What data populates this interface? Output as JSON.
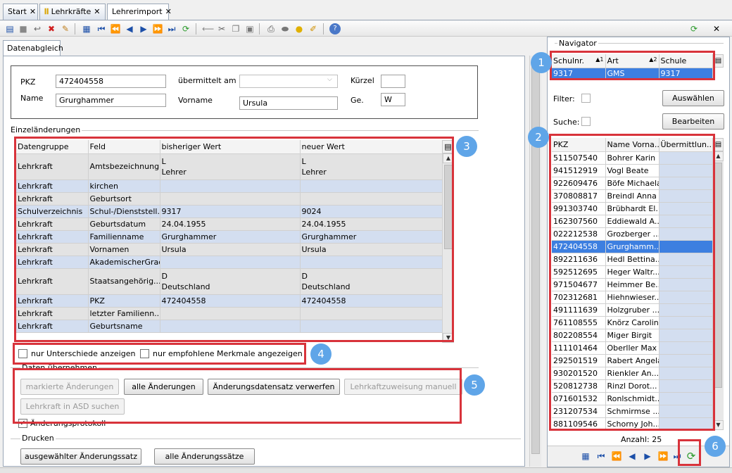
{
  "tabs": [
    {
      "label": "Start"
    },
    {
      "label": "Lehrkräfte"
    },
    {
      "label": "Lehrerimport"
    }
  ],
  "subtab": "Datenabgleich",
  "form": {
    "pkz_label": "PKZ",
    "pkz_value": "472404558",
    "uebermittelt_label": "übermittelt am",
    "uebermittelt_value": "",
    "kuerzel_label": "Kürzel",
    "kuerzel_value": "",
    "name_label": "Name",
    "name_value": "Grurghammer",
    "vorname_label": "Vorname",
    "vorname_value": "Ursula",
    "ge_label": "Ge.",
    "ge_value": "W"
  },
  "einzel": {
    "title": "Einzeländerungen",
    "headers": [
      "Datengruppe",
      "Feld",
      "bisheriger Wert",
      "neuer Wert"
    ],
    "rows": [
      {
        "c": [
          "Lehrkraft",
          "Amtsbezeichnung",
          "L\nLehrer",
          "L\nLehrer"
        ],
        "tall": true,
        "s": "r1"
      },
      {
        "c": [
          "Lehrkraft",
          "kirchen",
          "",
          ""
        ],
        "s": "r2"
      },
      {
        "c": [
          "Lehrkraft",
          "Geburtsort",
          "",
          ""
        ],
        "s": "r1"
      },
      {
        "c": [
          "Schulverzeichnis",
          "Schul-/Dienststell...",
          "9317",
          "9024"
        ],
        "s": "r2"
      },
      {
        "c": [
          "Lehrkraft",
          "Geburtsdatum",
          "24.04.1955",
          "24.04.1955"
        ],
        "s": "r1"
      },
      {
        "c": [
          "Lehrkraft",
          "Familienname",
          "Grurghammer",
          "Grurghammer"
        ],
        "s": "r2"
      },
      {
        "c": [
          "Lehrkraft",
          "Vornamen",
          "Ursula",
          "Ursula"
        ],
        "s": "r1"
      },
      {
        "c": [
          "Lehrkraft",
          "AkademischerGrad",
          "",
          ""
        ],
        "s": "r2"
      },
      {
        "c": [
          "Lehrkraft",
          "Staatsangehörig...",
          "D\nDeutschland",
          "D\nDeutschland"
        ],
        "tall": true,
        "s": "r1"
      },
      {
        "c": [
          "Lehrkraft",
          "PKZ",
          "472404558",
          "472404558"
        ],
        "s": "r2"
      },
      {
        "c": [
          "Lehrkraft",
          "letzter Familienn...",
          "",
          ""
        ],
        "s": "r1"
      },
      {
        "c": [
          "Lehrkraft",
          "Geburtsname",
          "",
          ""
        ],
        "s": "r2"
      }
    ]
  },
  "options": {
    "nur_unterschiede": "nur Unterschiede anzeigen",
    "nur_empfohlene": "nur empfohlene Merkmale angezeigen"
  },
  "daten": {
    "title": "Daten übernehmen",
    "markierte": "markierte Änderungen",
    "alle": "alle Änderungen",
    "verwerfen": "Änderungsdatensatz verwerfen",
    "zuweisung": "Lehrkaftzuweisung manuell",
    "asd": "Lehrkraft in ASD suchen",
    "protokoll": "Änderungsprotokoll"
  },
  "drucken": {
    "title": "Drucken",
    "ausgewaehlt": "ausgewählter Änderungssatz",
    "alle": "alle Änderungssätze"
  },
  "navigator": {
    "title": "Navigator",
    "school_headers": [
      "Schulnr.",
      "Art",
      "Schule"
    ],
    "school_sort": [
      "1",
      "2"
    ],
    "school_row": [
      "9317",
      "GMS",
      "9317"
    ],
    "filter_label": "Filter:",
    "suche_label": "Suche:",
    "auswaehlen": "Auswählen",
    "bearbeiten": "Bearbeiten",
    "list_headers": [
      "PKZ",
      "Name Vorna...",
      "Übermittlun..."
    ],
    "list": [
      [
        "511507540",
        "Bohrer Karin"
      ],
      [
        "941512919",
        "Vogl Beate"
      ],
      [
        "922609476",
        "Böfe Michaela"
      ],
      [
        "370808817",
        "Breindl Anna"
      ],
      [
        "991303740",
        "Brübhardt El..."
      ],
      [
        "162307560",
        "Eddiewald A..."
      ],
      [
        "022212538",
        "Grozberger ..."
      ],
      [
        "472404558",
        "Grurghamm..."
      ],
      [
        "892211636",
        "Hedl Bettina..."
      ],
      [
        "592512695",
        "Heger Waltr..."
      ],
      [
        "971504677",
        "Heimmer Be..."
      ],
      [
        "702312681",
        "Hiehnwieser..."
      ],
      [
        "491111639",
        "Holzgruber ..."
      ],
      [
        "761108555",
        "Knörz Carolin"
      ],
      [
        "802208554",
        "Miger Birgit"
      ],
      [
        "111101464",
        "Oberller Max"
      ],
      [
        "292501519",
        "Rabert Angela"
      ],
      [
        "930201520",
        "Rienkler An..."
      ],
      [
        "520812738",
        "Rinzl Dorot..."
      ],
      [
        "071601532",
        "Ronlschmidt..."
      ],
      [
        "231207534",
        "Schmirmse ..."
      ],
      [
        "881109546",
        "Schorny Joh..."
      ]
    ],
    "selected_index": 7,
    "count_label": "Anzahl: 25"
  },
  "badges": [
    "1",
    "2",
    "3",
    "4",
    "5",
    "6"
  ],
  "colors": {
    "highlight": "#d8333b",
    "badge": "#5fa5e8",
    "selection": "#3d7fe0"
  }
}
